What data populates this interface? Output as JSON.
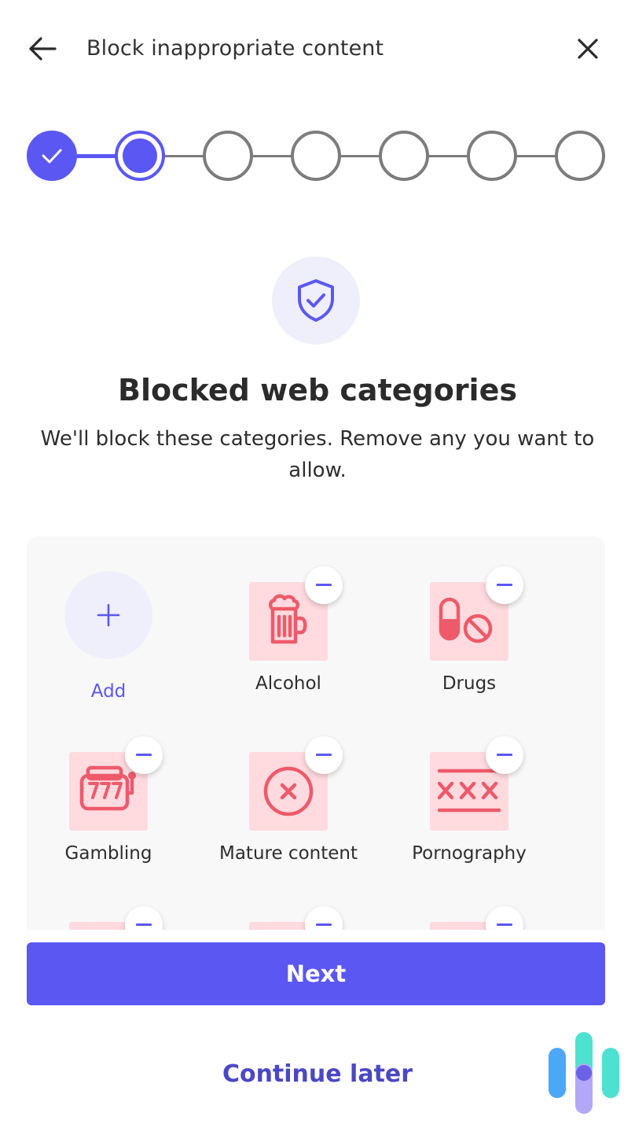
{
  "header": {
    "title": "Block inappropriate content",
    "back_icon": "arrow-left-icon",
    "close_icon": "close-icon"
  },
  "stepper": {
    "total_steps": 7,
    "completed_steps": 1,
    "current_step": 2
  },
  "hero": {
    "icon": "shield-check-icon",
    "title": "Blocked web categories",
    "subtitle": "We'll block these categories. Remove any you want to allow."
  },
  "categories": {
    "add_label": "Add",
    "items": [
      {
        "label": "Alcohol",
        "icon": "beer-mug-icon"
      },
      {
        "label": "Drugs",
        "icon": "pill-prohibited-icon"
      },
      {
        "label": "Gambling",
        "icon": "slot-machine-icon"
      },
      {
        "label": "Mature content",
        "icon": "circle-x-icon"
      },
      {
        "label": "Pornography",
        "icon": "xxx-icon"
      }
    ],
    "remove_icon": "minus-icon"
  },
  "actions": {
    "next_label": "Next",
    "continue_later_label": "Continue later"
  },
  "colors": {
    "accent": "#5b57f3",
    "accent_dark": "#4b47c4",
    "tile_bg": "#ffdadf",
    "tile_icon": "#ee5a6a",
    "soft_circle": "#efeffb"
  }
}
